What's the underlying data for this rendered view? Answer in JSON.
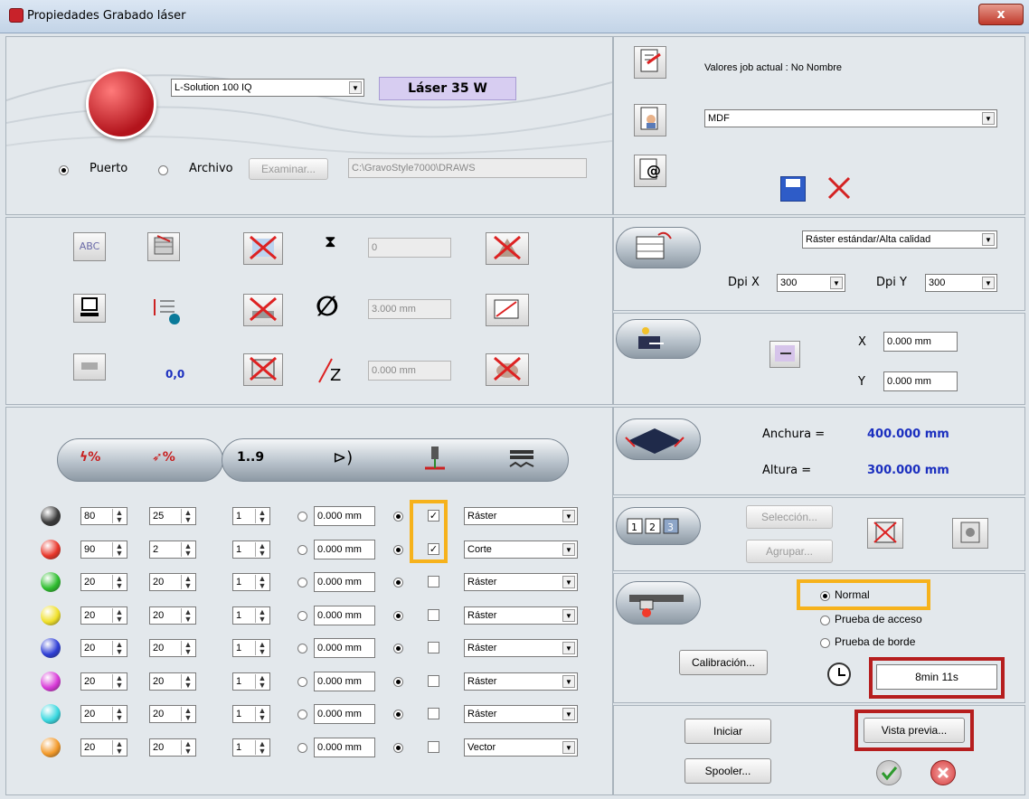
{
  "window": {
    "title": "Propiedades Grabado láser",
    "close": "x"
  },
  "top_left": {
    "machine": "L-Solution 100 IQ",
    "laser_power": "Láser 35 W",
    "port_label": "Puerto",
    "file_label": "Archivo",
    "browse": "Examinar...",
    "path": "C:\\GravoStyle7000\\DRAWS"
  },
  "top_right": {
    "job_values": "Valores job actual : No Nombre",
    "material": "MDF"
  },
  "tools": {
    "counter_value": "0",
    "diameter_value": "3.000 mm",
    "z_value": "0.000 mm",
    "coord_value": "0,0"
  },
  "raster": {
    "mode": "Ráster estándar/Alta calidad",
    "dpi_x_label": "Dpi X",
    "dpi_x": "300",
    "dpi_y_label": "Dpi Y",
    "dpi_y": "300"
  },
  "offset": {
    "x_label": "X",
    "x": "0.000 mm",
    "y_label": "Y",
    "y": "0.000 mm"
  },
  "size": {
    "width_label": "Anchura =",
    "width": "400.000 mm",
    "height_label": "Altura =",
    "height": "300.000 mm"
  },
  "pages": {
    "selection": "Selección...",
    "group": "Agrupar..."
  },
  "run_mode": {
    "normal": "Normal",
    "access": "Prueba de acceso",
    "border": "Prueba de borde",
    "calibration": "Calibración...",
    "time": "8min 11s"
  },
  "actions": {
    "start": "Iniciar",
    "preview": "Vista previa...",
    "spooler": "Spooler..."
  },
  "colors": [
    {
      "color": "#3a3a3a",
      "power": "80",
      "speed": "25",
      "passes": "1",
      "offset": "0.000 mm",
      "checked": true,
      "mode": "Ráster"
    },
    {
      "color": "#e8362a",
      "power": "90",
      "speed": "2",
      "passes": "1",
      "offset": "0.000 mm",
      "checked": true,
      "mode": "Corte"
    },
    {
      "color": "#2fbe2f",
      "power": "20",
      "speed": "20",
      "passes": "1",
      "offset": "0.000 mm",
      "checked": false,
      "mode": "Ráster"
    },
    {
      "color": "#f0e02a",
      "power": "20",
      "speed": "20",
      "passes": "1",
      "offset": "0.000 mm",
      "checked": false,
      "mode": "Ráster"
    },
    {
      "color": "#2f3fd6",
      "power": "20",
      "speed": "20",
      "passes": "1",
      "offset": "0.000 mm",
      "checked": false,
      "mode": "Ráster"
    },
    {
      "color": "#d83ad8",
      "power": "20",
      "speed": "20",
      "passes": "1",
      "offset": "0.000 mm",
      "checked": false,
      "mode": "Ráster"
    },
    {
      "color": "#3ad8e0",
      "power": "20",
      "speed": "20",
      "passes": "1",
      "offset": "0.000 mm",
      "checked": false,
      "mode": "Ráster"
    },
    {
      "color": "#f39a2a",
      "power": "20",
      "speed": "20",
      "passes": "1",
      "offset": "0.000 mm",
      "checked": false,
      "mode": "Vector"
    }
  ]
}
